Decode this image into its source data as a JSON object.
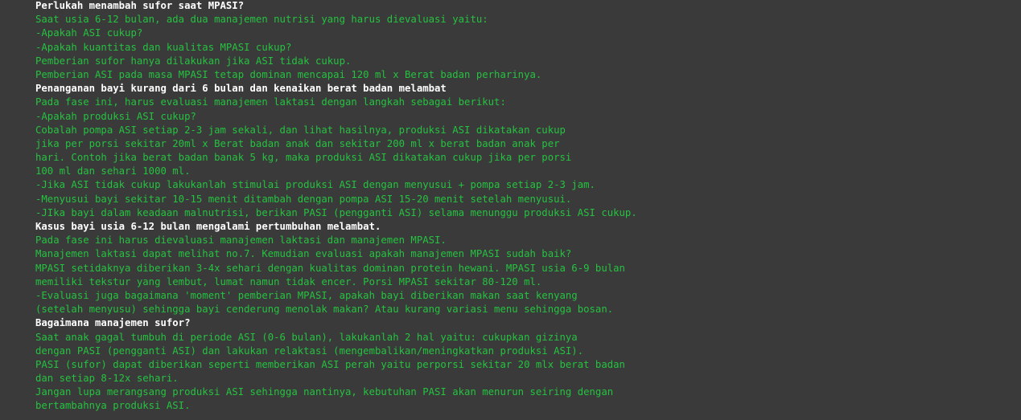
{
  "colors": {
    "background": "#3a3a3a",
    "heading": "#ffffff",
    "body_text": "#25c240"
  },
  "output": {
    "lines": [
      {
        "kind": "heading",
        "text": "Perlukah menambah sufor saat MPASI?"
      },
      {
        "kind": "text",
        "text": "Saat usia 6-12 bulan, ada dua manajemen nutrisi yang harus dievaluasi yaitu:"
      },
      {
        "kind": "text",
        "text": "-Apakah ASI cukup?"
      },
      {
        "kind": "text",
        "text": "-Apakah kuantitas dan kualitas MPASI cukup?"
      },
      {
        "kind": "text",
        "text": "Pemberian sufor hanya dilakukan jika ASI tidak cukup."
      },
      {
        "kind": "text",
        "text": "Pemberian ASI pada masa MPASI tetap dominan mencapai 120 ml x Berat badan perharinya."
      },
      {
        "kind": "heading",
        "text": "Penanganan bayi kurang dari 6 bulan dan kenaikan berat badan melambat"
      },
      {
        "kind": "text",
        "text": "Pada fase ini, harus evaluasi manajemen laktasi dengan langkah sebagai berikut:"
      },
      {
        "kind": "text",
        "text": "-Apakah produksi ASI cukup?"
      },
      {
        "kind": "text",
        "text": "Cobalah pompa ASI setiap 2-3 jam sekali, dan lihat hasilnya, produksi ASI dikatakan cukup"
      },
      {
        "kind": "text",
        "text": "jika per porsi sekitar 20ml x Berat badan anak dan sekitar 200 ml x berat badan anak per"
      },
      {
        "kind": "text",
        "text": "hari. Contoh jika berat badan banak 5 kg, maka produksi ASI dikatakan cukup jika per porsi"
      },
      {
        "kind": "text",
        "text": "100 ml dan sehari 1000 ml."
      },
      {
        "kind": "text",
        "text": "-Jika ASI tidak cukup lakukanlah stimulai produksi ASI dengan menyusui + pompa setiap 2-3 jam."
      },
      {
        "kind": "text",
        "text": "-Menyusui bayi sekitar 10-15 menit ditambah dengan pompa ASI 15-20 menit setelah menyusui."
      },
      {
        "kind": "text",
        "text": "-JIka bayi dalam keadaan malnutrisi, berikan PASI (pengganti ASI) selama menunggu produksi ASI cukup."
      },
      {
        "kind": "heading",
        "text": "Kasus bayi usia 6-12 bulan mengalami pertumbuhan melambat."
      },
      {
        "kind": "text",
        "text": "Pada fase ini harus dievaluasi manajemen laktasi dan manajemen MPASI."
      },
      {
        "kind": "text",
        "text": "Manajemen laktasi dapat melihat no.7. Kemudian evaluasi apakah manajemen MPASI sudah baik?"
      },
      {
        "kind": "text",
        "text": "MPASI setidaknya diberikan 3-4x sehari dengan kualitas dominan protein hewani. MPASI usia 6-9 bulan"
      },
      {
        "kind": "text",
        "text": "memiliki tekstur yang lembut, lumat namun tidak encer. Porsi MPASI sekitar 80-120 ml."
      },
      {
        "kind": "text",
        "text": "-Evaluasi juga bagaimana 'moment' pemberian MPASI, apakah bayi diberikan makan saat kenyang"
      },
      {
        "kind": "text",
        "text": "(setelah menyusu) sehingga bayi cenderung menolak makan? Atau kurang variasi menu sehingga bosan."
      },
      {
        "kind": "heading",
        "text": "Bagaimana manajemen sufor?"
      },
      {
        "kind": "text",
        "text": "Saat anak gagal tumbuh di periode ASI (0-6 bulan), lakukanlah 2 hal yaitu: cukupkan gizinya"
      },
      {
        "kind": "text",
        "text": "dengan PASI (pengganti ASI) dan lakukan relaktasi (mengembalikan/meningkatkan produksi ASI)."
      },
      {
        "kind": "text",
        "text": "PASI (sufor) dapat diberikan seperti memberikan ASI perah yaitu perporsi sekitar 20 mlx berat badan"
      },
      {
        "kind": "text",
        "text": "dan setiap 8-12x sehari."
      },
      {
        "kind": "text",
        "text": "Jangan lupa merangsang produksi ASI sehingga nantinya, kebutuhan PASI akan menurun seiring dengan"
      },
      {
        "kind": "text",
        "text": "bertambahnya produksi ASI."
      }
    ]
  }
}
